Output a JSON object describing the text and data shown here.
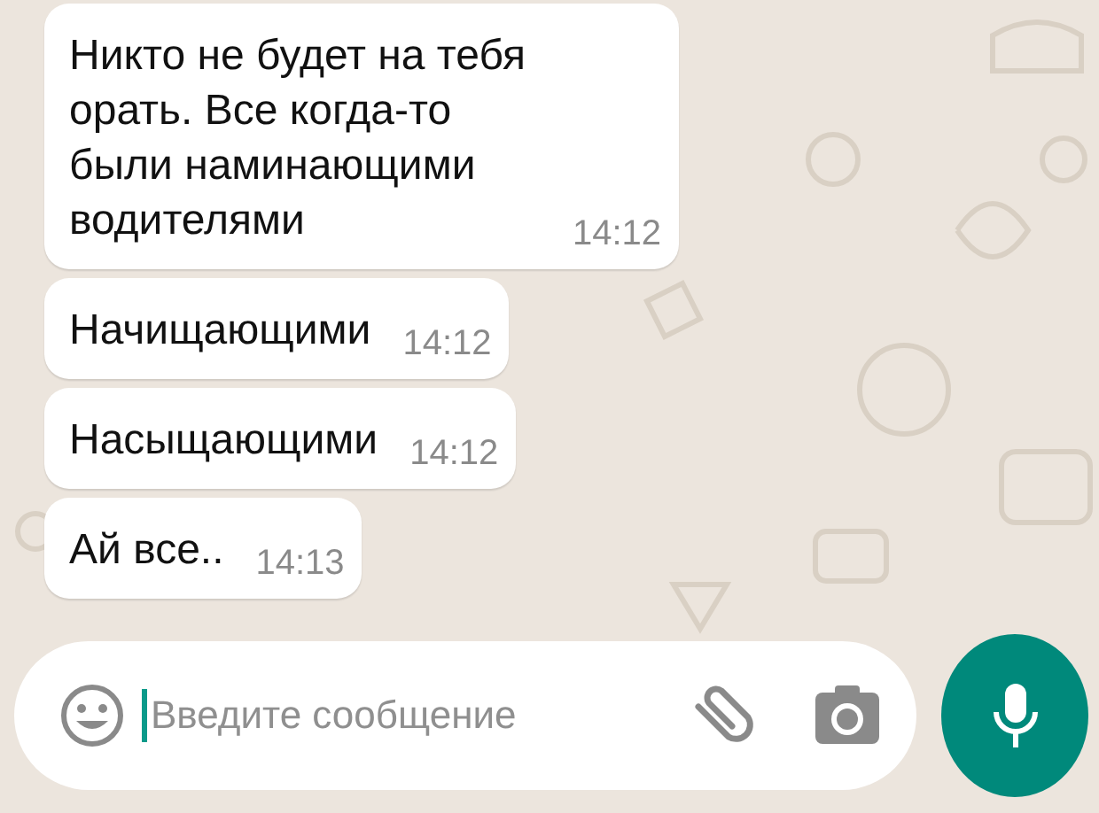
{
  "messages": [
    {
      "text": "Никто не будет на тебя орать. Все когда-то были наминающими водителями",
      "time": "14:12"
    },
    {
      "text": "Начищающими",
      "time": "14:12"
    },
    {
      "text": "Насыщающими",
      "time": "14:12"
    },
    {
      "text": "Ай все..",
      "time": "14:13"
    }
  ],
  "composer": {
    "placeholder": "Введите сообщение"
  }
}
